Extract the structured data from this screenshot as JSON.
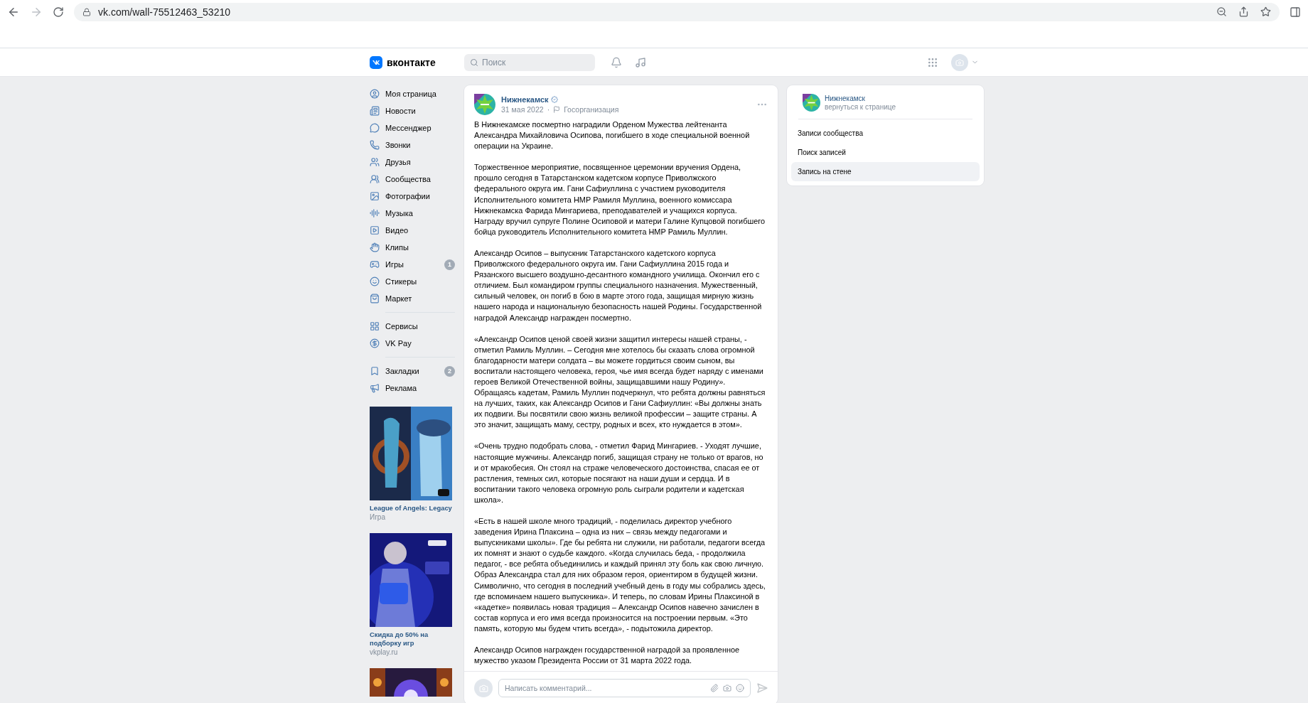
{
  "browser": {
    "url": "vk.com/wall-75512463_53210"
  },
  "header": {
    "logo": "вконтакте",
    "search": {
      "placeholder": "Поиск"
    }
  },
  "sidebar": {
    "groups": [
      [
        {
          "label": "Моя страница"
        },
        {
          "label": "Новости"
        },
        {
          "label": "Мессенджер"
        },
        {
          "label": "Звонки"
        },
        {
          "label": "Друзья"
        },
        {
          "label": "Сообщества"
        },
        {
          "label": "Фотографии"
        },
        {
          "label": "Музыка"
        },
        {
          "label": "Видео"
        },
        {
          "label": "Клипы"
        },
        {
          "label": "Игры",
          "badge": "1"
        },
        {
          "label": "Стикеры"
        },
        {
          "label": "Маркет"
        }
      ],
      [
        {
          "label": "Сервисы"
        },
        {
          "label": "VK Pay"
        }
      ],
      [
        {
          "label": "Закладки",
          "badge": "2"
        },
        {
          "label": "Реклама"
        }
      ]
    ],
    "ads": [
      {
        "kind": "picture",
        "title": "League of Angels: Legacy",
        "subtitle": "Игра"
      },
      {
        "kind": "picture",
        "title": "Скидка до 50% на подборку игр",
        "subtitle": "vkplay.ru"
      },
      {
        "kind": "picture"
      }
    ]
  },
  "post": {
    "author": "Нижнекамск",
    "verified": true,
    "date": "31 мая 2022",
    "separator": "·",
    "category": "Госорганизация",
    "paragraphs": [
      "В Нижнекамске посмертно наградили Орденом Мужества лейтенанта Александра Михайловича Осипова, погибшего в ходе специальной военной операции на Украине.",
      "Торжественное мероприятие, посвященное церемонии вручения Ордена, прошло сегодня в Татарстанском кадетском корпусе Приволжского федерального округа им. Гани Сафиуллина с участием руководителя Исполнительного комитета НМР Рамиля Муллина, военного комиссара Нижнекамска Фарида Мингариева, преподавателей и учащихся корпуса. Награду вручил супруге Полине Осиповой и матери Галине Купцовой погибшего бойца руководитель Исполнительного комитета НМР Рамиль Муллин.",
      "Александр Осипов – выпускник Татарстанского кадетского корпуса Приволжского федерального округа им. Гани Сафиуллина 2015 года и Рязанского высшего воздушно-десантного командного училища. Окончил его с отличием. Был командиром группы специального назначения. Мужественный, сильный человек, он погиб в бою в марте этого года, защищая мирную жизнь нашего народа и национальную безопасность нашей Родины. Государственной наградой Александр награжден посмертно.",
      "«Александр Осипов ценой своей жизни защитил интересы нашей страны, - отметил Рамиль Муллин. – Сегодня мне хотелось бы сказать слова огромной благодарности матери солдата – вы можете гордиться своим сыном, вы воспитали настоящего человека, героя, чье имя всегда будет наряду с именами героев Великой Отечественной войны, защищавшими нашу Родину». Обращаясь кадетам, Рамиль Муллин подчеркнул, что ребята должны равняться на лучших, таких, как Александр Осипов и Гани Сафиуллин: «Вы должны знать их подвиги. Вы посвятили свою жизнь великой профессии – защите страны. А это значит, защищать маму, сестру, родных и всех, кто нуждается в этом».",
      "«Очень трудно подобрать слова, - отметил Фарид Мингариев. - Уходят лучшие, настоящие мужчины. Александр погиб, защищая страну не только от врагов, но и от мракобесия. Он стоял на страже человеческого достоинства, спасая ее от растления, темных сил, которые посягают на наши души и сердца. И в воспитании такого человека огромную роль сыграли родители и кадетская школа».",
      "«Есть в нашей школе много традиций, - поделилась директор учебного заведения Ирина Плаксина – одна из них – связь между педагогами и выпускниками школы». Где бы ребята ни служили, ни работали, педагоги всегда их помнят и знают о судьбе каждого. «Когда случилась беда, - продолжила педагог, - все ребята объединились и каждый принял эту боль как свою личную. Образ Александра стал для них образом героя, ориентиром в будущей жизни. Символично, что сегодня в последний учебный день в году мы собрались здесь, где вспоминаем нашего выпускника». И теперь, по словам Ирины Плаксиной в «кадетке» появилась новая традиция – Александр Осипов навечно зачислен в состав корпуса и его имя всегда произносится на построении первым. «Это память, которую мы будем чтить всегда», - подытожила директор.",
      "Александр Осипов награжден государственной наградой за проявленное мужество указом Президента России от 31 марта 2022 года."
    ],
    "comment": {
      "placeholder": "Написать комментарий..."
    }
  },
  "side_panel": {
    "community": "Нижнекамск",
    "back_link": "вернуться к странице",
    "items": [
      {
        "label": "Записи сообщества",
        "selected": false
      },
      {
        "label": "Поиск записей",
        "selected": false
      },
      {
        "label": "Запись на стене",
        "selected": true
      }
    ]
  }
}
